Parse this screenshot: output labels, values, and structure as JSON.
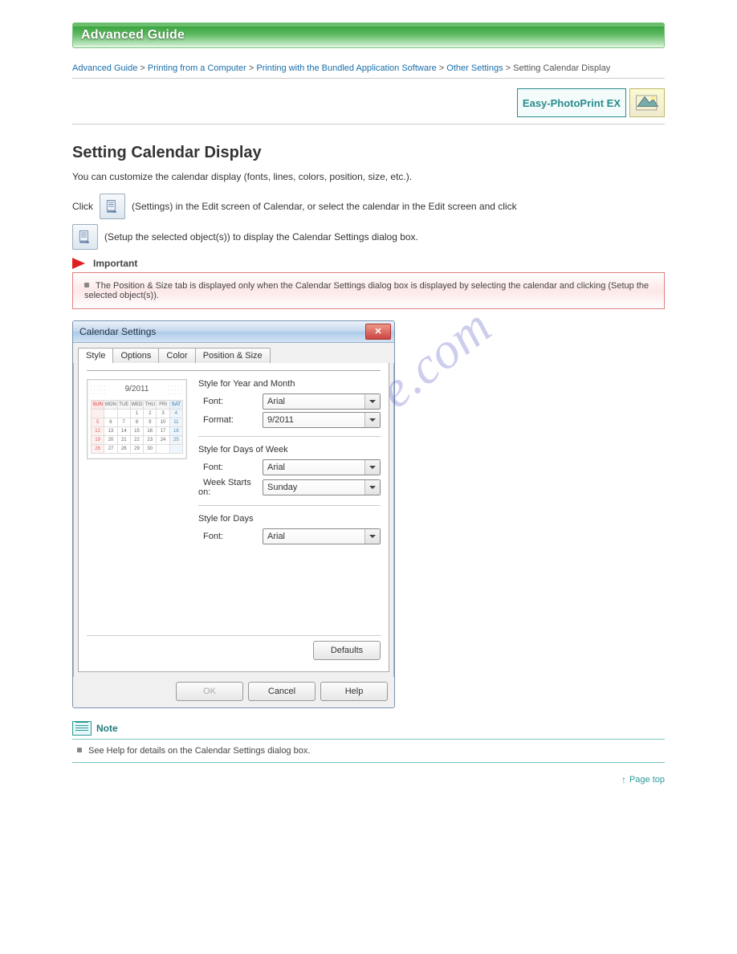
{
  "watermark": "manualshive.com",
  "header": {
    "title": "Advanced Guide"
  },
  "breadcrumb": {
    "seg1": "Advanced Guide",
    "seg2": "Printing from a Computer",
    "seg3": "Printing with the Bundled Application Software",
    "seg4": "Other Settings",
    "seg5": "Setting Calendar Display"
  },
  "logo": {
    "text": "Easy-PhotoPrint EX"
  },
  "page_title": "Setting Calendar Display",
  "intro": "You can customize the calendar display (fonts, lines, colors, position, size, etc.).",
  "step_click": "Click",
  "step_tail": "(Settings) in the Edit screen of Calendar, or select the calendar in the Edit screen and click",
  "step_tail2": "(Setup the selected object(s)) to display the Calendar Settings dialog box.",
  "important": {
    "label": "Important",
    "text": "The Position & Size tab is displayed only when the Calendar Settings dialog box is displayed by selecting the calendar and clicking         (Setup the selected object(s))."
  },
  "dialog": {
    "title": "Calendar Settings",
    "tabs": [
      "Style",
      "Options",
      "Color",
      "Position & Size"
    ],
    "section1": {
      "title": "Style for Year and Month",
      "font_label": "Font:",
      "font_value": "Arial",
      "format_label": "Format:",
      "format_value": "9/2011"
    },
    "section2": {
      "title": "Style for Days of Week",
      "font_label": "Font:",
      "font_value": "Arial",
      "wso_label": "Week Starts on:",
      "wso_value": "Sunday"
    },
    "section3": {
      "title": "Style for Days",
      "font_label": "Font:",
      "font_value": "Arial"
    },
    "preview_title": "9/2011",
    "defaults": "Defaults",
    "ok": "OK",
    "cancel": "Cancel",
    "help": "Help"
  },
  "calendar": {
    "dow": [
      "SUN",
      "MON",
      "TUE",
      "WED",
      "THU",
      "FRI",
      "SAT"
    ],
    "rows": [
      [
        "",
        "",
        "",
        "1",
        "2",
        "3",
        "4"
      ],
      [
        "5",
        "6",
        "7",
        "8",
        "9",
        "10",
        "11"
      ],
      [
        "12",
        "13",
        "14",
        "15",
        "16",
        "17",
        "18"
      ],
      [
        "19",
        "20",
        "21",
        "22",
        "23",
        "24",
        "25"
      ],
      [
        "26",
        "27",
        "28",
        "29",
        "30",
        "",
        ""
      ]
    ]
  },
  "note": {
    "label": "Note",
    "prefix": "See Help for details on the Calendar Settings dialog box."
  },
  "pagetop": "Page top"
}
